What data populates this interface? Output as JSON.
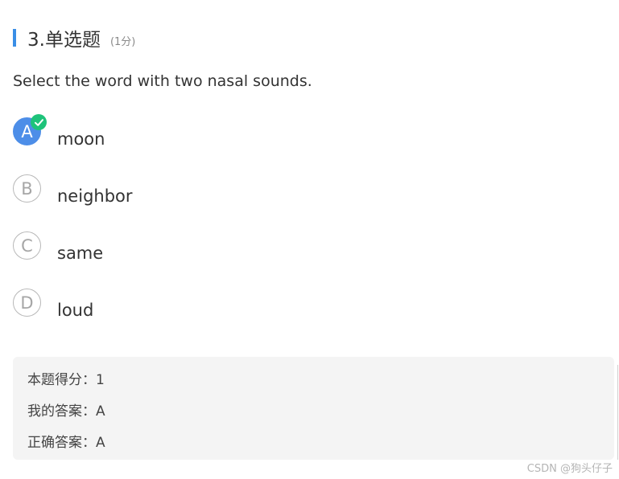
{
  "question": {
    "title": "3.单选题",
    "score": "(1分)",
    "text": "Select the word with two nasal sounds."
  },
  "options": [
    {
      "letter": "A",
      "label": "moon",
      "selected": true
    },
    {
      "letter": "B",
      "label": "neighbor",
      "selected": false
    },
    {
      "letter": "C",
      "label": "same",
      "selected": false
    },
    {
      "letter": "D",
      "label": "loud",
      "selected": false
    }
  ],
  "result": {
    "score_line": "本题得分：1",
    "my_answer_line": "我的答案：A",
    "correct_answer_line": "正确答案：A"
  },
  "watermark": "CSDN @狗头仔子",
  "colors": {
    "accent": "#3a8ee6",
    "selected_option": "#4d8ee8",
    "check_badge": "#1ec37a",
    "result_bg": "#f4f4f4"
  },
  "icons": {
    "correct": "check-icon"
  }
}
